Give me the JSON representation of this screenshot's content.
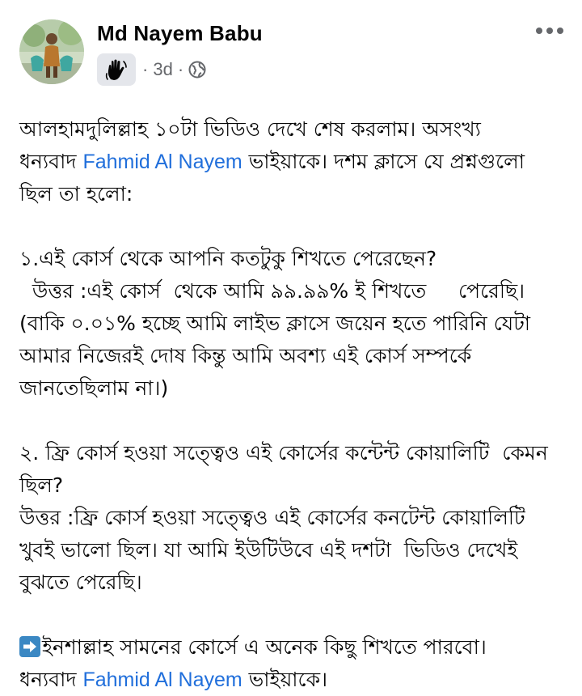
{
  "post": {
    "author": "Md Nayem Babu",
    "time": "3d",
    "separator": "·",
    "more_label": "•••"
  },
  "content": {
    "p1": {
      "l1": "আলহামদুলিল্লাহ ১০টা ভিডিও দেখে শেষ করলাম। অসংখ্য",
      "l2_before": "ধন্যবাদ ",
      "l2_link": "Fahmid Al Nayem",
      "l2_after": " ভাইয়াকে। দশম ক্লাসে যে প্রশ্নগুলো",
      "l3": "ছিল তা হলো:"
    },
    "q1": {
      "question": "১.এই কোর্স থেকে আপনি কতটুকু শিখতে পেরেছেন?",
      "answer_l1": "  উত্তর :এই কোর্স  থেকে আমি ৯৯.৯৯% ই শিখতে     পেরেছি।",
      "answer_l2": "(বাকি ০.০১% হচ্ছে আমি লাইভ ক্লাসে জয়েন হতে পারিনি যেটা",
      "answer_l3": "আমার নিজেরই দোষ কিন্তু আমি অবশ্য এই কোর্স সম্পর্কে",
      "answer_l4": "জানতেছিলাম না।)"
    },
    "q2": {
      "question_l1": "২. ফ্রি কোর্স হওয়া সত্ত্বেও এই কোর্সের কন্টেন্ট কোয়ালিটি  কেমন",
      "question_l2": "ছিল?",
      "answer_l1": "উত্তর :ফ্রি কোর্স হওয়া সত্ত্বেও এই কোর্সের কনটেন্ট কোয়ালিটি",
      "answer_l2": "খুবই ভালো ছিল। যা আমি ইউটিউবে এই দশটা  ভিডিও দেখেই",
      "answer_l3": "বুঝতে পেরেছি।"
    },
    "closing": {
      "l1": "ইনশাল্লাহ সামনের কোর্সে এ অনেক কিছু শিখতে পারবো।",
      "l2_before": "ধন্যবাদ ",
      "l2_link": "Fahmid Al Nayem",
      "l2_after": " ভাইয়াকে।"
    }
  },
  "icons": {
    "avatar": "profile-photo",
    "badge": "waving-hand-icon",
    "privacy": "globe-icon",
    "more": "more-options-icon",
    "arrow": "right-arrow-emoji"
  },
  "colors": {
    "link": "#216fdb",
    "meta": "#65676b",
    "text": "#050505",
    "badge_bg": "#e4e6eb"
  }
}
